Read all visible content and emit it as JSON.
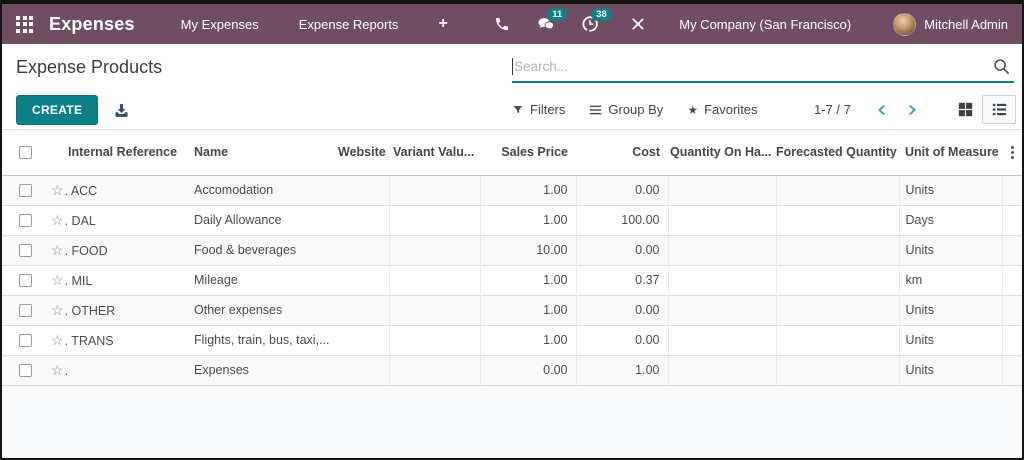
{
  "nav": {
    "brand": "Expenses",
    "items": [
      {
        "label": "My Expenses"
      },
      {
        "label": "Expense Reports"
      },
      {
        "label": "+"
      }
    ],
    "message_badge": "11",
    "activity_badge": "38",
    "company": "My Company (San Francisco)",
    "user": "Mitchell Admin"
  },
  "breadcrumb": {
    "title": "Expense Products"
  },
  "search": {
    "placeholder": "Search..."
  },
  "control_panel": {
    "create_label": "CREATE",
    "filters_label": "Filters",
    "group_by_label": "Group By",
    "favorites_label": "Favorites",
    "pager": "1-7 / 7"
  },
  "table": {
    "columns": {
      "internal_reference": "Internal Reference",
      "name": "Name",
      "website": "Website",
      "variant_values": "Variant Valu...",
      "sales_price": "Sales Price",
      "cost": "Cost",
      "quantity_on_hand": "Quantity On Ha...",
      "forecasted_quantity": "Forecasted Quantity",
      "unit_of_measure": "Unit of Measure"
    },
    "rows": [
      {
        "ref": ". ACC",
        "name": "Accomodation",
        "website": "",
        "variant": "",
        "sales_price": "1.00",
        "cost": "0.00",
        "qty_on_hand": "",
        "forecasted": "",
        "uom": "Units"
      },
      {
        "ref": ". DAL",
        "name": "Daily Allowance",
        "website": "",
        "variant": "",
        "sales_price": "1.00",
        "cost": "100.00",
        "qty_on_hand": "",
        "forecasted": "",
        "uom": "Days"
      },
      {
        "ref": ". FOOD",
        "name": "Food & beverages",
        "website": "",
        "variant": "",
        "sales_price": "10.00",
        "cost": "0.00",
        "qty_on_hand": "",
        "forecasted": "",
        "uom": "Units"
      },
      {
        "ref": ". MIL",
        "name": "Mileage",
        "website": "",
        "variant": "",
        "sales_price": "1.00",
        "cost": "0.37",
        "qty_on_hand": "",
        "forecasted": "",
        "uom": "km"
      },
      {
        "ref": ". OTHER",
        "name": "Other expenses",
        "website": "",
        "variant": "",
        "sales_price": "1.00",
        "cost": "0.00",
        "qty_on_hand": "",
        "forecasted": "",
        "uom": "Units"
      },
      {
        "ref": ". TRANS",
        "name": "Flights, train, bus, taxi,...",
        "website": "",
        "variant": "",
        "sales_price": "1.00",
        "cost": "0.00",
        "qty_on_hand": "",
        "forecasted": "",
        "uom": "Units"
      },
      {
        "ref": ".",
        "name": "Expenses",
        "website": "",
        "variant": "",
        "sales_price": "0.00",
        "cost": "1.00",
        "qty_on_hand": "",
        "forecasted": "",
        "uom": "Units"
      }
    ]
  },
  "colors": {
    "topbar": "#6f4d63",
    "primary_teal": "#0d7f86",
    "badge_teal": "#0e8186",
    "pager_arrow": "#35a0b8",
    "export_icon": "#2d4c71"
  }
}
